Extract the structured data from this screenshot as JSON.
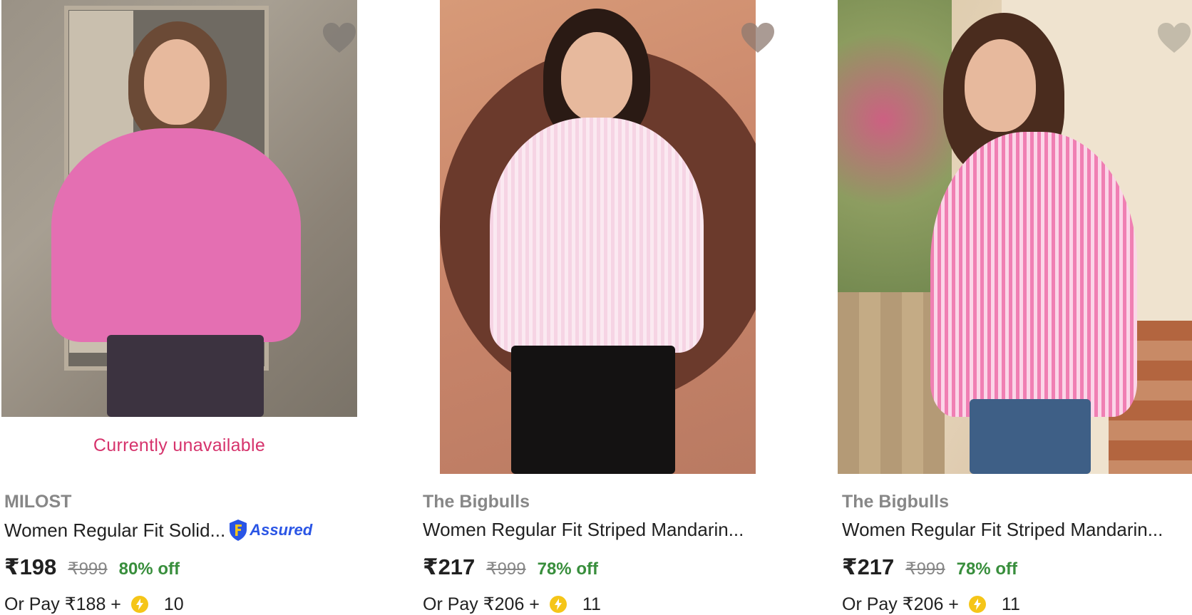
{
  "products": [
    {
      "brand": "MILOST",
      "title": "Women Regular Fit Solid...",
      "assured_label": "Assured",
      "status": "Currently unavailable",
      "price": "₹198",
      "mrp": "₹999",
      "discount": "80% off",
      "pay_prefix": "Or Pay ₹188 +",
      "coins": "10"
    },
    {
      "brand": "The Bigbulls",
      "title": "Women Regular Fit Striped Mandarin...",
      "price": "₹217",
      "mrp": "₹999",
      "discount": "78% off",
      "pay_prefix": "Or Pay ₹206 +",
      "coins": "11"
    },
    {
      "brand": "The Bigbulls",
      "title": "Women Regular Fit Striped Mandarin...",
      "price": "₹217",
      "mrp": "₹999",
      "discount": "78% off",
      "pay_prefix": "Or Pay ₹206 +",
      "coins": "11"
    }
  ],
  "colors": {
    "brand_text": "#878787",
    "discount": "#388e3c",
    "unavailable": "#d6336c",
    "assured": "#2a55e5",
    "coin": "#f5c518"
  },
  "icons": {
    "wishlist": "heart-icon",
    "assured": "flipkart-assured-badge-icon",
    "coin": "supercoin-icon"
  }
}
